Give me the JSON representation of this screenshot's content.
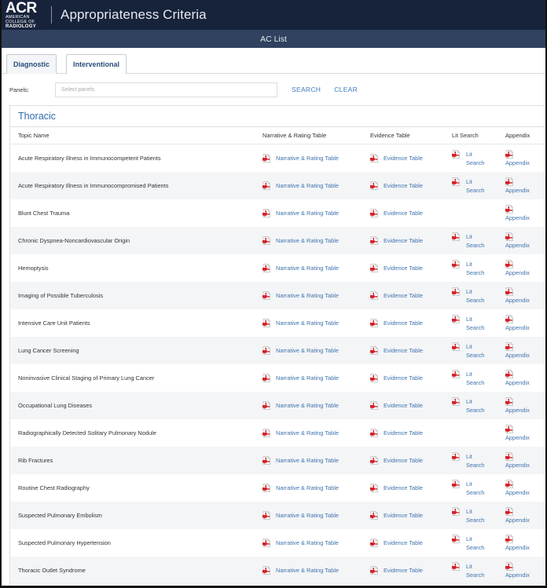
{
  "header": {
    "logo_main": "ACR",
    "logo_sub": "AMERICAN COLLEGE OF",
    "logo_sub2": "RADIOLOGY",
    "app_title": "Appropriateness Criteria"
  },
  "subbar": {
    "title": "AC List"
  },
  "tabs": [
    {
      "label": "Diagnostic",
      "active": true
    },
    {
      "label": "Interventional",
      "active": false
    }
  ],
  "filter": {
    "panels_label": "Panels:",
    "panels_placeholder": "Select panels",
    "search_label": "SEARCH",
    "clear_label": "CLEAR"
  },
  "section": {
    "title": "Thoracic",
    "columns": {
      "topic": "Topic Name",
      "narrative": "Narrative & Rating Table",
      "evidence": "Evidence Table",
      "lit": "Lit Search",
      "appendix": "Appendix"
    },
    "link_labels": {
      "narrative": "Narrative & Rating Table",
      "evidence": "Evidence Table",
      "lit_line1": "Lit",
      "lit_line2": "Search",
      "appendix": "Appendix"
    },
    "rows": [
      {
        "topic": "Acute Respiratory Illness in Immunocompetent Patients",
        "narrative": true,
        "evidence": true,
        "lit": true,
        "appendix": true
      },
      {
        "topic": "Acute Respiratory Illness in Immunocompromised Patients",
        "narrative": true,
        "evidence": true,
        "lit": true,
        "appendix": true
      },
      {
        "topic": "Blunt Chest Trauma",
        "narrative": true,
        "evidence": true,
        "lit": false,
        "appendix": true
      },
      {
        "topic": "Chronic Dyspnea-Noncardiovascular Origin",
        "narrative": true,
        "evidence": true,
        "lit": true,
        "appendix": true
      },
      {
        "topic": "Hemoptysis",
        "narrative": true,
        "evidence": true,
        "lit": true,
        "appendix": true
      },
      {
        "topic": "Imaging of Possible Tuberculosis",
        "narrative": true,
        "evidence": true,
        "lit": true,
        "appendix": true
      },
      {
        "topic": "Intensive Care Unit Patients",
        "narrative": true,
        "evidence": true,
        "lit": true,
        "appendix": true
      },
      {
        "topic": "Lung Cancer Screening",
        "narrative": true,
        "evidence": true,
        "lit": true,
        "appendix": true
      },
      {
        "topic": "Noninvasive Clinical Staging of Primary Lung Cancer",
        "narrative": true,
        "evidence": true,
        "lit": true,
        "appendix": true
      },
      {
        "topic": "Occupational Lung Diseases",
        "narrative": true,
        "evidence": true,
        "lit": true,
        "appendix": true
      },
      {
        "topic": "Radiographically Detected Solitary Pulmonary Nodule",
        "narrative": true,
        "evidence": true,
        "lit": false,
        "appendix": true
      },
      {
        "topic": "Rib Fractures",
        "narrative": true,
        "evidence": true,
        "lit": true,
        "appendix": true
      },
      {
        "topic": "Routine Chest Radiography",
        "narrative": true,
        "evidence": true,
        "lit": true,
        "appendix": true
      },
      {
        "topic": "Suspected Pulmonary Embolism",
        "narrative": true,
        "evidence": true,
        "lit": true,
        "appendix": true
      },
      {
        "topic": "Suspected Pulmonary Hypertension",
        "narrative": true,
        "evidence": true,
        "lit": true,
        "appendix": true
      },
      {
        "topic": "Thoracic Outlet Syndrome",
        "narrative": true,
        "evidence": true,
        "lit": true,
        "appendix": true
      }
    ]
  },
  "colors": {
    "topbar": "#17233b",
    "subbar": "#30425f",
    "link": "#3f73ad",
    "pdf_red": "#d42027"
  },
  "icons": {
    "document": "pdf-icon"
  }
}
